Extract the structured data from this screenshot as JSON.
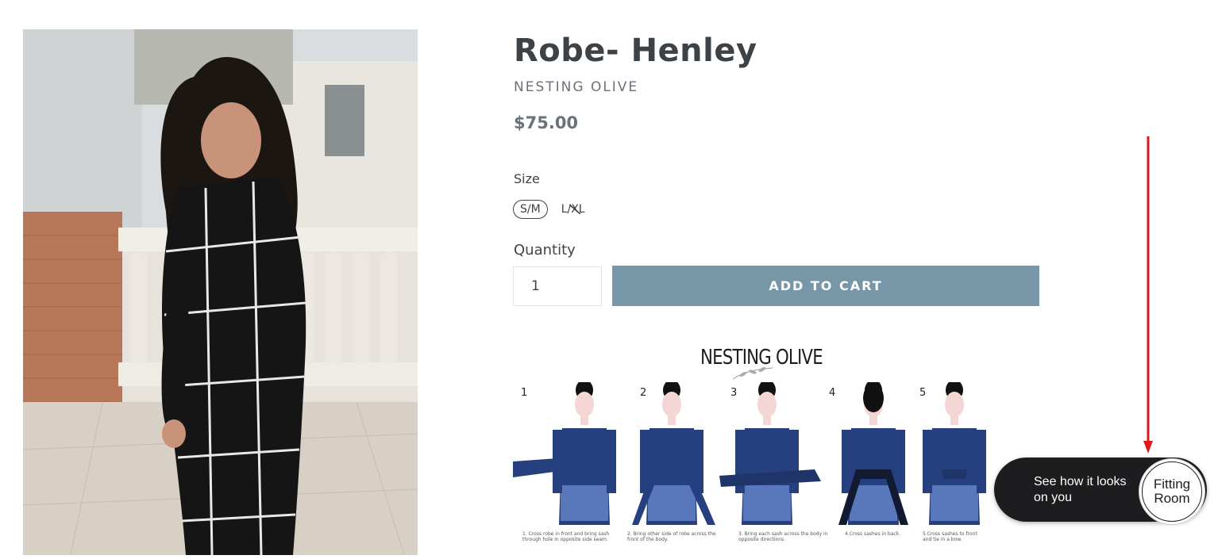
{
  "product": {
    "title": "Robe- Henley",
    "vendor": "NESTING OLIVE",
    "price": "$75.00",
    "size_label": "Size",
    "sizes": [
      {
        "label": "S/M",
        "selected": true,
        "available": true
      },
      {
        "label": "L/XL",
        "selected": false,
        "available": false
      }
    ],
    "quantity_label": "Quantity",
    "quantity_value": "1",
    "add_to_cart_label": "ADD TO CART",
    "accent_color": "#7796a8"
  },
  "howto": {
    "logo": "NESTING OLIVE",
    "steps": [
      {
        "num": "1",
        "caption": "1. Cross robe in front and bring sash through hole in opposite side seam."
      },
      {
        "num": "2",
        "caption": "2. Bring other side of robe across the front of the body."
      },
      {
        "num": "3",
        "caption": "3. Bring each sash across the body in opposite directions."
      },
      {
        "num": "4",
        "caption": "4.Cross sashes in back."
      },
      {
        "num": "5",
        "caption": "5.Cross sashes to front and tie in a bow."
      }
    ]
  },
  "fitting_room": {
    "prompt": "See how it looks on you",
    "button_label": "Fitting Room"
  },
  "icons": [
    "arrow-down-icon"
  ]
}
